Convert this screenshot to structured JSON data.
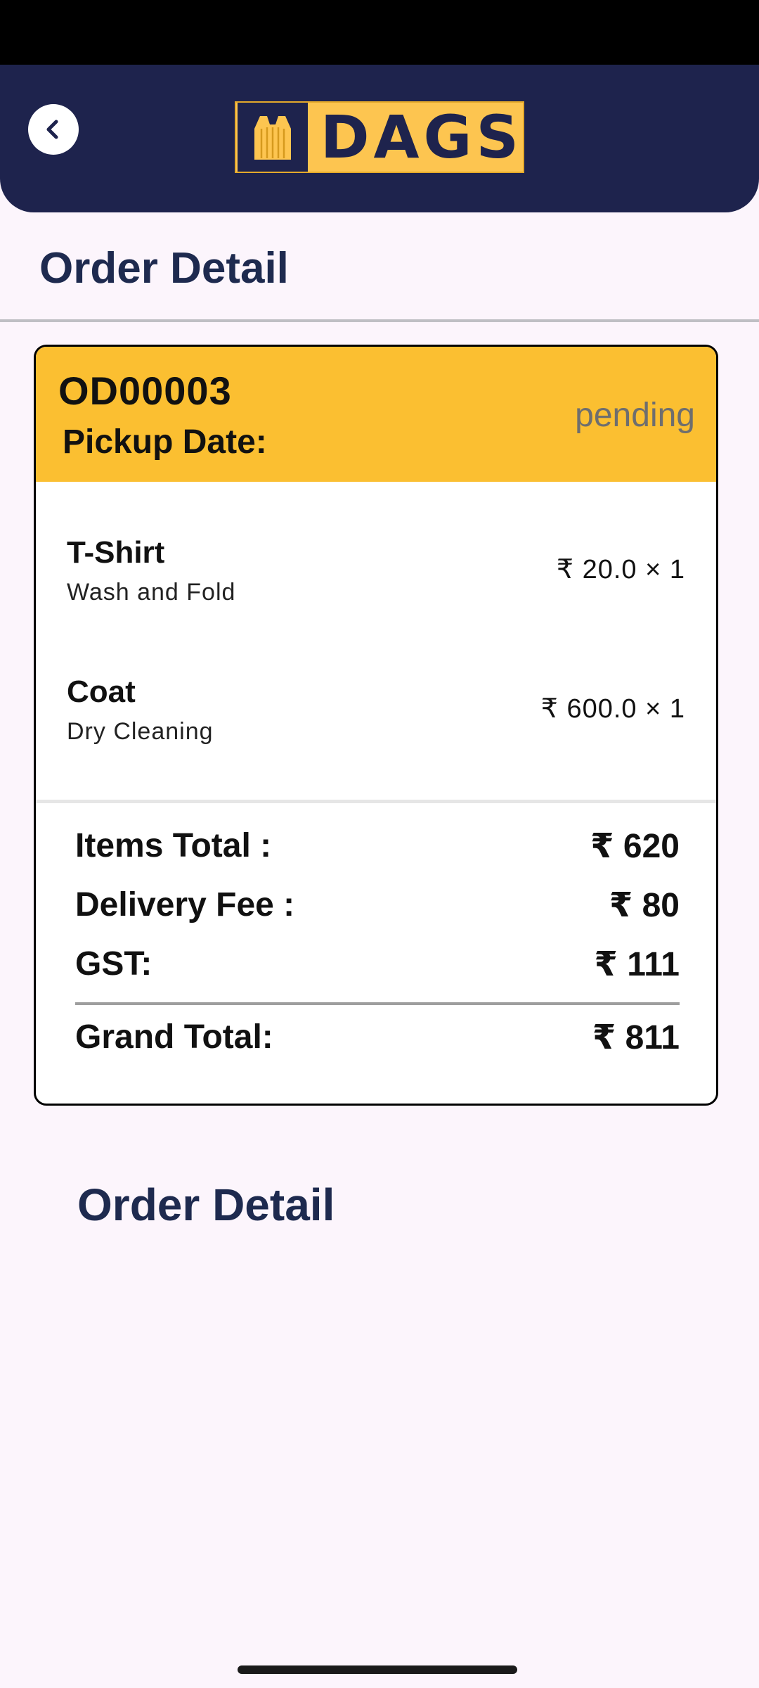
{
  "header": {
    "logo_text": "DAGS",
    "back_icon": "chevron-left-icon",
    "colors": {
      "primary": "#1e234d",
      "accent": "#fdc550"
    }
  },
  "page": {
    "title": "Order Detail"
  },
  "order": {
    "id": "OD00003",
    "pickup_label": "Pickup Date:",
    "status": "pending",
    "items": [
      {
        "name": "T-Shirt",
        "service": "Wash and Fold",
        "price": "₹ 20.0 × 1"
      },
      {
        "name": "Coat",
        "service": "Dry Cleaning",
        "price": "₹ 600.0 × 1"
      }
    ],
    "summary": {
      "items_total_label": "Items Total :",
      "items_total_value": "₹ 620",
      "delivery_fee_label": "Delivery Fee :",
      "delivery_fee_value": "₹ 80",
      "gst_label": "GST:",
      "gst_value": "₹ 111",
      "grand_total_label": "Grand Total:",
      "grand_total_value": "₹ 811"
    }
  },
  "section": {
    "heading": "Order Detail"
  }
}
